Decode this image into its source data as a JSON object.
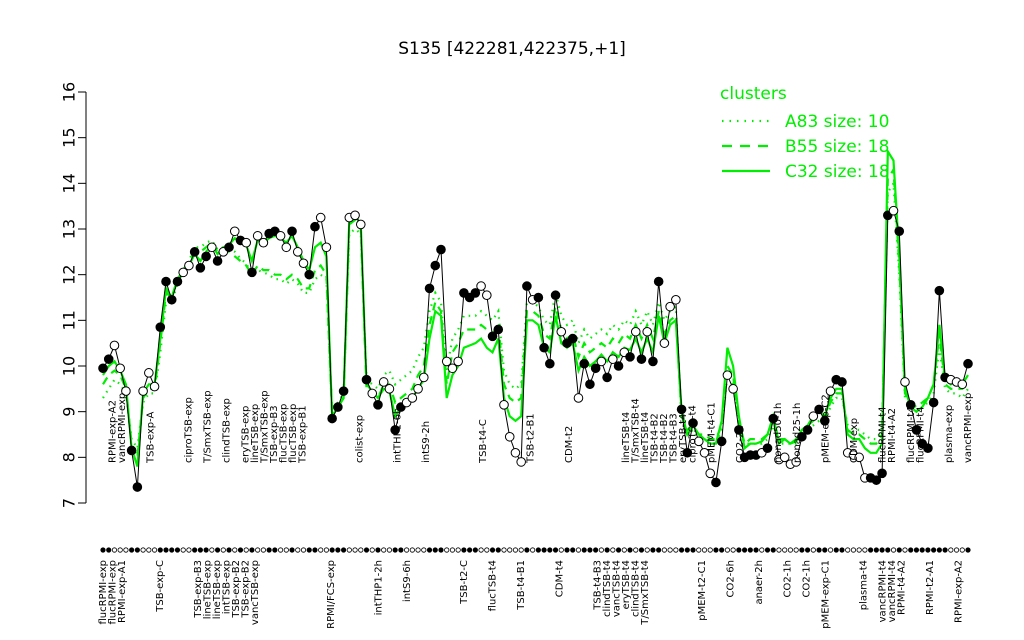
{
  "chart_data": {
    "type": "line",
    "title": "S135 [422281,422375,+1]",
    "xlabel": "",
    "ylabel": "",
    "ylim": [
      7,
      16
    ],
    "yticks": [
      7,
      8,
      9,
      10,
      11,
      12,
      13,
      14,
      15,
      16
    ],
    "grid": false,
    "legend": {
      "title": "clusters",
      "placement": "top-right",
      "entries": [
        {
          "label": "A83 size: 10",
          "style": "dotted"
        },
        {
          "label": "B55 size: 18",
          "style": "dashed"
        },
        {
          "label": "C32 size: 18",
          "style": "solid"
        }
      ]
    },
    "colors": {
      "cluster": "#00ee00",
      "data": "#000000"
    },
    "top_labels": [
      {
        "i": 1,
        "text": "RPMI-exp-A2"
      },
      {
        "i": 2,
        "text": "vancRPMI-exp"
      },
      {
        "i": 5,
        "text": "TSB-exp-A"
      },
      {
        "i": 9,
        "text": "ciproTSB-exp"
      },
      {
        "i": 11,
        "text": "T/SmxTSB-exp"
      },
      {
        "i": 13,
        "text": "clindTSB-exp"
      },
      {
        "i": 15,
        "text": "eryTSB-exp"
      },
      {
        "i": 16,
        "text": "lineTSB-exp"
      },
      {
        "i": 17,
        "text": "T/SmxTSB-exp"
      },
      {
        "i": 18,
        "text": "TSB-exp-B3"
      },
      {
        "i": 19,
        "text": "flucTSB-exp"
      },
      {
        "i": 20,
        "text": "flucTSB-exp"
      },
      {
        "i": 21,
        "text": "TSB-exp-B1"
      },
      {
        "i": 27,
        "text": "colist-exp"
      },
      {
        "i": 31,
        "text": "intTHP1-6h"
      },
      {
        "i": 34,
        "text": "intS9-2h"
      },
      {
        "i": 40,
        "text": "TSB-t4-C"
      },
      {
        "i": 45,
        "text": "TSB-t2-B1"
      },
      {
        "i": 49,
        "text": "CDM-t2"
      },
      {
        "i": 55,
        "text": "lineTSB-t4"
      },
      {
        "i": 56,
        "text": "T/SmxTSB-t4"
      },
      {
        "i": 57,
        "text": "lineTSB-t4"
      },
      {
        "i": 58,
        "text": "TSB-t4-B2"
      },
      {
        "i": 59,
        "text": "TSB-t4-B2"
      },
      {
        "i": 60,
        "text": "TSB-t4-B3"
      },
      {
        "i": 61,
        "text": "eryTSB-t4"
      },
      {
        "i": 62,
        "text": "ciproTSB-t4"
      },
      {
        "i": 64,
        "text": "pMEM-t4-C1"
      },
      {
        "i": 67,
        "text": "CO2-2h"
      },
      {
        "i": 71,
        "text": "nonad50-1h"
      },
      {
        "i": 73,
        "text": "nonad25-1h"
      },
      {
        "i": 76,
        "text": "pMEM-exp-C2"
      },
      {
        "i": 79,
        "text": "CDM-exp"
      },
      {
        "i": 82,
        "text": "flucRPMI-t4"
      },
      {
        "i": 83,
        "text": "RPMI-t4-A2"
      },
      {
        "i": 85,
        "text": "flucRPMI-t4"
      },
      {
        "i": 86,
        "text": "flucRPMI-t4"
      },
      {
        "i": 89,
        "text": "plasma-exp"
      },
      {
        "i": 91,
        "text": "vancRPMI-exp"
      }
    ],
    "bottom_labels": [
      {
        "i": 0,
        "text": "flucRPMI-exp"
      },
      {
        "i": 1,
        "text": "flucRPMI-exp"
      },
      {
        "i": 2,
        "text": "RPMI-exp-A1"
      },
      {
        "i": 6,
        "text": "TSB-exp-C"
      },
      {
        "i": 10,
        "text": "TSB-exp-B3"
      },
      {
        "i": 11,
        "text": "lineTSB-exp"
      },
      {
        "i": 12,
        "text": "lineTSB-exp"
      },
      {
        "i": 13,
        "text": "intTSB-exp"
      },
      {
        "i": 14,
        "text": "TSB-exp-B2"
      },
      {
        "i": 15,
        "text": "TSB-exp-B2"
      },
      {
        "i": 16,
        "text": "vancTSB-exp"
      },
      {
        "i": 24,
        "text": "RPMI/FCS-exp"
      },
      {
        "i": 29,
        "text": "intTHP1-2h"
      },
      {
        "i": 32,
        "text": "intS9-6h"
      },
      {
        "i": 38,
        "text": "TSB-t2-C"
      },
      {
        "i": 41,
        "text": "flucTSB-t4"
      },
      {
        "i": 44,
        "text": "TSB-t4-B1"
      },
      {
        "i": 48,
        "text": "CDM-t4"
      },
      {
        "i": 52,
        "text": "TSB-t4-B3"
      },
      {
        "i": 53,
        "text": "clindTSB-t4"
      },
      {
        "i": 54,
        "text": "vancTSB-t4"
      },
      {
        "i": 55,
        "text": "eryTSB-t4"
      },
      {
        "i": 56,
        "text": "clindTSB-t4"
      },
      {
        "i": 57,
        "text": "T/SmxTSB-t4"
      },
      {
        "i": 63,
        "text": "pMEM-t2-C1"
      },
      {
        "i": 66,
        "text": "CO2-6h"
      },
      {
        "i": 69,
        "text": "anaer-2h"
      },
      {
        "i": 72,
        "text": "CO2-1h"
      },
      {
        "i": 74,
        "text": "CO2-1h"
      },
      {
        "i": 76,
        "text": "pMEM-exp-C1"
      },
      {
        "i": 80,
        "text": "plasma-t4"
      },
      {
        "i": 82,
        "text": "vancRPMI-t4"
      },
      {
        "i": 83,
        "text": "vancRPMI-t4"
      },
      {
        "i": 84,
        "text": "RPMI-t4-A2"
      },
      {
        "i": 87,
        "text": "RPMI-t2-A1"
      },
      {
        "i": 90,
        "text": "RPMI-exp-A2"
      }
    ],
    "series": [
      {
        "role": "data",
        "values": [
          9.95,
          10.15,
          10.45,
          9.95,
          9.45,
          8.15,
          7.35,
          9.45,
          9.85,
          9.55,
          10.85,
          11.85,
          11.45,
          11.85,
          12.05,
          12.2,
          12.5,
          12.15,
          12.4,
          12.6,
          12.3,
          12.5,
          12.6,
          12.95,
          12.75,
          12.7,
          12.05,
          12.85,
          12.7,
          12.9,
          12.95,
          12.85,
          12.6,
          12.95,
          12.5,
          12.25,
          12.0,
          13.05,
          13.25,
          12.6,
          8.85,
          9.1,
          9.45,
          13.25,
          13.3,
          13.1,
          9.7,
          9.4,
          9.15,
          9.65,
          9.5,
          8.6,
          9.1,
          9.2,
          9.3,
          9.5,
          9.75,
          11.7,
          12.2,
          12.55,
          10.1,
          9.95,
          10.1,
          11.6,
          11.5,
          11.6,
          11.75,
          11.55,
          10.65,
          10.8,
          9.15,
          8.45,
          8.1,
          7.9,
          11.75,
          11.45,
          11.5,
          10.4,
          10.05,
          11.55,
          10.75,
          10.5,
          10.6,
          9.3,
          10.05,
          9.6,
          9.95,
          10.1,
          9.75,
          10.15,
          10.0,
          10.3,
          10.2,
          10.75,
          10.15,
          10.75,
          10.1,
          11.85,
          10.5,
          11.3,
          11.45,
          9.05,
          8.1,
          8.75,
          8.35,
          8.1,
          7.65,
          7.45,
          8.35,
          9.8,
          9.5,
          8.6,
          8.0,
          8.05,
          8.05,
          8.1,
          8.2,
          8.85,
          7.95,
          8.0,
          7.85,
          7.9,
          8.45,
          8.6,
          8.9,
          9.05,
          8.8,
          9.45,
          9.7,
          9.65,
          8.1,
          8.05,
          8.0,
          7.55,
          7.55,
          7.5,
          7.65,
          13.3,
          13.4,
          12.95,
          9.65,
          9.15,
          8.6,
          8.3,
          8.2,
          9.2,
          11.65,
          9.75,
          9.7,
          9.65,
          9.6,
          10.05
        ]
      },
      {
        "role": "cluster",
        "name": "C32",
        "values": [
          9.8,
          10.0,
          10.1,
          9.9,
          9.6,
          8.2,
          7.8,
          9.4,
          9.6,
          9.6,
          10.6,
          11.7,
          11.5,
          11.9,
          12.0,
          12.2,
          12.45,
          12.3,
          12.5,
          12.65,
          12.45,
          12.6,
          12.65,
          12.8,
          12.7,
          12.65,
          12.3,
          12.75,
          12.7,
          12.8,
          12.85,
          12.8,
          12.7,
          12.85,
          12.6,
          12.3,
          12.1,
          12.6,
          12.7,
          12.4,
          8.9,
          9.1,
          9.3,
          13.2,
          13.3,
          13.1,
          9.6,
          9.45,
          9.3,
          9.5,
          9.45,
          8.9,
          9.1,
          9.2,
          9.3,
          9.5,
          9.7,
          10.6,
          11.2,
          11.1,
          9.3,
          9.8,
          10.0,
          10.4,
          10.45,
          10.5,
          10.6,
          10.4,
          10.3,
          10.6,
          9.3,
          8.9,
          8.8,
          8.9,
          11.0,
          11.0,
          10.9,
          10.4,
          10.3,
          11.1,
          10.5,
          10.4,
          10.5,
          9.9,
          10.2,
          10.0,
          10.1,
          10.25,
          10.1,
          10.3,
          10.2,
          10.4,
          10.35,
          10.6,
          10.3,
          10.6,
          10.3,
          11.1,
          10.5,
          10.9,
          11.0,
          9.0,
          8.5,
          8.7,
          8.5,
          8.4,
          8.3,
          8.3,
          8.8,
          10.4,
          10.0,
          8.9,
          8.2,
          8.3,
          8.3,
          8.35,
          8.5,
          8.9,
          8.3,
          8.4,
          8.3,
          8.35,
          8.6,
          8.7,
          8.9,
          9.0,
          8.9,
          9.3,
          9.5,
          9.5,
          8.5,
          8.4,
          8.4,
          8.2,
          8.1,
          8.1,
          8.3,
          14.7,
          14.5,
          12.4,
          9.5,
          9.1,
          9.0,
          9.1,
          9.3,
          9.6,
          10.9,
          9.7,
          9.6,
          9.7,
          9.6,
          9.8
        ]
      },
      {
        "role": "cluster",
        "name": "B55",
        "values": [
          9.6,
          9.8,
          9.9,
          9.8,
          9.5,
          8.3,
          8.0,
          9.3,
          9.5,
          9.5,
          10.5,
          11.6,
          11.5,
          11.9,
          12.1,
          12.3,
          12.5,
          12.5,
          12.6,
          12.7,
          12.5,
          12.55,
          12.5,
          12.4,
          12.3,
          12.2,
          12.0,
          12.2,
          12.1,
          12.1,
          12.0,
          12.0,
          11.9,
          12.0,
          11.9,
          11.7,
          11.7,
          12.1,
          12.2,
          12.0,
          8.9,
          9.1,
          9.3,
          13.1,
          13.2,
          13.0,
          9.5,
          9.4,
          9.3,
          9.6,
          9.6,
          9.2,
          9.3,
          9.4,
          9.5,
          9.8,
          10.0,
          10.9,
          11.4,
          11.2,
          9.6,
          10.3,
          10.5,
          10.8,
          10.8,
          10.8,
          10.9,
          10.8,
          10.7,
          10.9,
          9.6,
          9.3,
          9.2,
          9.3,
          11.2,
          11.2,
          11.1,
          10.7,
          10.6,
          11.3,
          10.8,
          10.6,
          10.7,
          10.2,
          10.5,
          10.3,
          10.4,
          10.5,
          10.4,
          10.6,
          10.5,
          10.7,
          10.6,
          10.9,
          10.6,
          10.9,
          10.6,
          11.2,
          10.7,
          11.0,
          11.1,
          8.9,
          8.6,
          8.7,
          8.5,
          8.5,
          8.4,
          8.4,
          8.7,
          10.0,
          9.8,
          8.8,
          8.3,
          8.4,
          8.4,
          8.4,
          8.5,
          8.8,
          8.4,
          8.4,
          8.3,
          8.4,
          8.6,
          8.7,
          8.8,
          8.9,
          8.9,
          9.2,
          9.4,
          9.4,
          8.6,
          8.5,
          8.5,
          8.4,
          8.3,
          8.3,
          8.5,
          14.1,
          14.3,
          12.2,
          9.4,
          9.2,
          9.1,
          9.2,
          9.3,
          9.6,
          10.7,
          9.6,
          9.5,
          9.5,
          9.5,
          9.6
        ]
      },
      {
        "role": "cluster",
        "name": "A83",
        "values": [
          9.3,
          9.5,
          9.7,
          9.6,
          9.4,
          8.4,
          8.2,
          9.2,
          9.4,
          9.4,
          10.3,
          11.4,
          11.4,
          11.8,
          12.1,
          12.3,
          12.6,
          12.6,
          12.7,
          12.75,
          12.55,
          12.6,
          12.55,
          12.5,
          12.35,
          12.25,
          12.0,
          12.1,
          12.05,
          12.0,
          11.9,
          11.9,
          11.8,
          11.9,
          11.8,
          11.6,
          11.6,
          11.9,
          12.0,
          11.9,
          9.0,
          9.2,
          9.4,
          12.9,
          13.0,
          12.9,
          9.7,
          9.6,
          9.5,
          9.8,
          9.9,
          9.6,
          9.7,
          9.8,
          9.9,
          10.2,
          10.4,
          11.2,
          11.6,
          11.4,
          9.9,
          10.6,
          10.8,
          11.1,
          11.1,
          11.1,
          11.2,
          11.1,
          11.0,
          11.2,
          9.9,
          9.6,
          9.5,
          9.6,
          11.4,
          11.4,
          11.3,
          11.0,
          10.9,
          11.6,
          11.1,
          10.9,
          11.0,
          10.5,
          10.8,
          10.6,
          10.7,
          10.8,
          10.7,
          10.9,
          10.8,
          11.0,
          10.9,
          11.2,
          10.9,
          11.2,
          10.9,
          11.4,
          11.0,
          11.2,
          11.3,
          8.8,
          8.5,
          8.6,
          8.4,
          8.4,
          8.3,
          8.3,
          8.6,
          9.8,
          9.6,
          8.7,
          8.3,
          8.3,
          8.3,
          8.3,
          8.4,
          8.7,
          8.3,
          8.3,
          8.3,
          8.3,
          8.5,
          8.6,
          8.7,
          8.8,
          8.8,
          9.1,
          9.3,
          9.3,
          8.7,
          8.6,
          8.6,
          8.5,
          8.4,
          8.4,
          8.6,
          13.8,
          14.0,
          12.0,
          9.3,
          9.1,
          9.0,
          9.1,
          9.2,
          9.4,
          10.4,
          9.5,
          9.4,
          9.4,
          9.3,
          9.5
        ]
      }
    ],
    "x_count": 152,
    "filled_markers": [
      0,
      1,
      5,
      6,
      10,
      11,
      12,
      13,
      16,
      17,
      18,
      20,
      22,
      24,
      26,
      29,
      30,
      33,
      36,
      37,
      40,
      41,
      42,
      46,
      48,
      51,
      52,
      57,
      58,
      59,
      63,
      64,
      65,
      68,
      69,
      74,
      76,
      77,
      78,
      79,
      81,
      82,
      84,
      85,
      86,
      88,
      90,
      92,
      94,
      96,
      97,
      101,
      102,
      103,
      107,
      108,
      111,
      112,
      113,
      114,
      116,
      117,
      122,
      123,
      125,
      126,
      128,
      129,
      134,
      135,
      136,
      137,
      139,
      141,
      142,
      143,
      144,
      145,
      146,
      147,
      151
    ]
  }
}
